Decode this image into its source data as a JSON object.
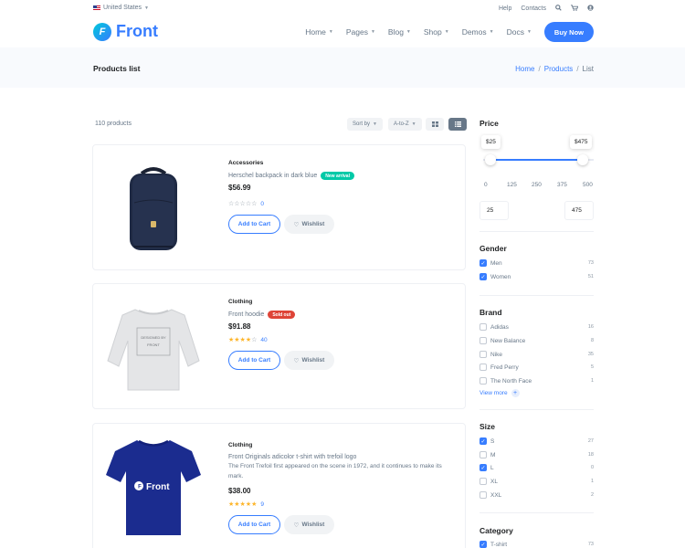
{
  "topbar": {
    "country": "United States",
    "links": [
      "Help",
      "Contacts"
    ],
    "icons": [
      "search-icon",
      "cart-icon",
      "user-icon"
    ]
  },
  "header": {
    "logo_letter": "F",
    "logo_text": "Front",
    "nav": [
      "Home",
      "Pages",
      "Blog",
      "Shop",
      "Demos",
      "Docs"
    ],
    "buy_label": "Buy Now"
  },
  "band": {
    "title": "Products list",
    "breadcrumb": [
      "Home",
      "Products",
      "List"
    ]
  },
  "toolbar": {
    "count": "110 products",
    "sort_label": "Sort by",
    "order_label": "A-to-Z"
  },
  "products": [
    {
      "category": "Accessories",
      "name": "Herschel backpack in dark blue",
      "badge": "New arrival",
      "badge_color": "#00c9a7",
      "description": "",
      "price": "$56.99",
      "rating": 0,
      "reviews": "0",
      "cart_label": "Add to Cart",
      "wishlist_label": "Wishlist"
    },
    {
      "category": "Clothing",
      "name": "Front hoodie",
      "badge": "Sold out",
      "badge_color": "#de4437",
      "description": "",
      "price": "$91.88",
      "rating": 4,
      "reviews": "40",
      "cart_label": "Add to Cart",
      "wishlist_label": "Wishlist"
    },
    {
      "category": "Clothing",
      "name": "Front Originals adicolor t-shirt with trefoil logo",
      "badge": "",
      "badge_color": "",
      "description": "The Front Trefoil first appeared on the scene in 1972, and it continues to make its mark.",
      "price": "$38.00",
      "rating": 5,
      "reviews": "9",
      "cart_label": "Add to Cart",
      "wishlist_label": "Wishlist"
    }
  ],
  "shirt_print": "Front",
  "sweatshirt_print": [
    "DESIGNED BY",
    "FRONT"
  ],
  "filters": {
    "price": {
      "title": "Price",
      "min_label": "$25",
      "max_label": "$475",
      "ticks": [
        "0",
        "125",
        "250",
        "375",
        "500"
      ],
      "min_value": "25",
      "max_value": "475"
    },
    "gender": {
      "title": "Gender",
      "options": [
        {
          "label": "Men",
          "count": "73",
          "checked": true
        },
        {
          "label": "Women",
          "count": "51",
          "checked": true
        }
      ]
    },
    "brand": {
      "title": "Brand",
      "options": [
        {
          "label": "Adidas",
          "count": "16",
          "checked": false
        },
        {
          "label": "New Balance",
          "count": "8",
          "checked": false
        },
        {
          "label": "Nike",
          "count": "35",
          "checked": false
        },
        {
          "label": "Fred Perry",
          "count": "5",
          "checked": false
        },
        {
          "label": "The North Face",
          "count": "1",
          "checked": false
        }
      ],
      "view_more": "View more"
    },
    "size": {
      "title": "Size",
      "options": [
        {
          "label": "S",
          "count": "27",
          "checked": true
        },
        {
          "label": "M",
          "count": "18",
          "checked": false
        },
        {
          "label": "L",
          "count": "0",
          "checked": true
        },
        {
          "label": "XL",
          "count": "1",
          "checked": false
        },
        {
          "label": "XXL",
          "count": "2",
          "checked": false
        }
      ]
    },
    "category": {
      "title": "Category",
      "options": [
        {
          "label": "T-shirt",
          "count": "73",
          "checked": true
        }
      ]
    }
  },
  "colors": {
    "primary": "#377dff",
    "star": "#fdb52a",
    "muted": "#677788"
  }
}
